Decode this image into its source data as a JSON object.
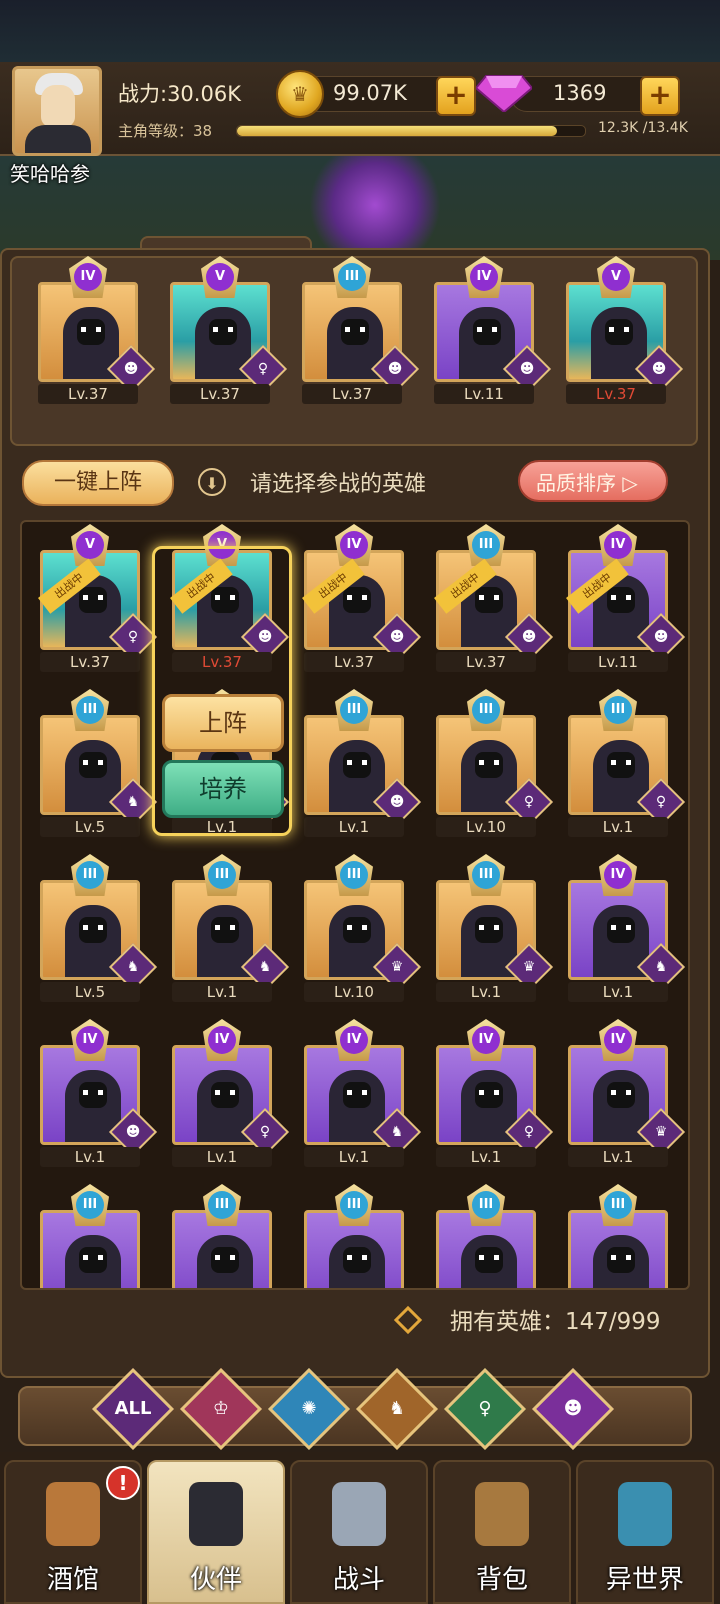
{
  "player": {
    "name": "笑哈哈参",
    "power": "战力:30.06K",
    "level_label": "主角等级：38",
    "xp_text": "12.3K /13.4K",
    "xp_fraction": 0.92
  },
  "currency": {
    "gold": "99.07K",
    "gems": "1369"
  },
  "lineup": [
    {
      "rank": "IV",
      "level": "Lv.37",
      "bg": "orange",
      "faction": "demon"
    },
    {
      "rank": "V",
      "level": "Lv.37",
      "bg": "teal",
      "faction": "elf"
    },
    {
      "rank": "III",
      "level": "Lv.37",
      "bg": "orange",
      "faction": "demon"
    },
    {
      "rank": "IV",
      "level": "Lv.11",
      "bg": "purple",
      "faction": "demon"
    },
    {
      "rank": "V",
      "level": "Lv.37",
      "bg": "teal",
      "faction": "demon",
      "level_red": true
    }
  ],
  "controls": {
    "one_click": "一键上阵",
    "hint": "请选择参战的英雄",
    "sort": "品质排序 ▷"
  },
  "deployed_tag": "出战中",
  "popup": {
    "deploy": "上阵",
    "train": "培养"
  },
  "roster": [
    {
      "rank": "V",
      "level": "Lv.37",
      "bg": "teal",
      "faction": "elf",
      "deployed": true
    },
    {
      "rank": "V",
      "level": "Lv.37",
      "bg": "teal",
      "faction": "demon",
      "deployed": true,
      "level_red": true
    },
    {
      "rank": "IV",
      "level": "Lv.37",
      "bg": "orange",
      "faction": "demon",
      "deployed": true
    },
    {
      "rank": "III",
      "level": "Lv.37",
      "bg": "orange",
      "faction": "demon",
      "deployed": true
    },
    {
      "rank": "IV",
      "level": "Lv.11",
      "bg": "purple",
      "faction": "demon",
      "deployed": true
    },
    {
      "rank": "III",
      "level": "Lv.5",
      "bg": "orange",
      "faction": "beast"
    },
    {
      "rank": "III",
      "level": "Lv.1",
      "bg": "orange",
      "faction": "beast"
    },
    {
      "rank": "III",
      "level": "Lv.1",
      "bg": "orange",
      "faction": "demon"
    },
    {
      "rank": "III",
      "level": "Lv.10",
      "bg": "orange",
      "faction": "elf"
    },
    {
      "rank": "III",
      "level": "Lv.1",
      "bg": "orange",
      "faction": "elf"
    },
    {
      "rank": "III",
      "level": "Lv.5",
      "bg": "orange",
      "faction": "beast"
    },
    {
      "rank": "III",
      "level": "Lv.1",
      "bg": "orange",
      "faction": "beast"
    },
    {
      "rank": "III",
      "level": "Lv.10",
      "bg": "orange",
      "faction": "human"
    },
    {
      "rank": "III",
      "level": "Lv.1",
      "bg": "orange",
      "faction": "human"
    },
    {
      "rank": "IV",
      "level": "Lv.1",
      "bg": "purple",
      "faction": "beast"
    },
    {
      "rank": "IV",
      "level": "Lv.1",
      "bg": "purple",
      "faction": "demon"
    },
    {
      "rank": "IV",
      "level": "Lv.1",
      "bg": "purple",
      "faction": "elf"
    },
    {
      "rank": "IV",
      "level": "Lv.1",
      "bg": "purple",
      "faction": "beast"
    },
    {
      "rank": "IV",
      "level": "Lv.1",
      "bg": "purple",
      "faction": "elf"
    },
    {
      "rank": "IV",
      "level": "Lv.1",
      "bg": "purple",
      "faction": "human"
    },
    {
      "rank": "III",
      "level": "",
      "bg": "purple",
      "faction": ""
    },
    {
      "rank": "III",
      "level": "",
      "bg": "purple",
      "faction": ""
    },
    {
      "rank": "III",
      "level": "",
      "bg": "purple",
      "faction": ""
    },
    {
      "rank": "III",
      "level": "",
      "bg": "purple",
      "faction": ""
    },
    {
      "rank": "III",
      "level": "",
      "bg": "purple",
      "faction": ""
    }
  ],
  "owned": "拥有英雄：147/999",
  "filters": [
    {
      "label": "ALL",
      "icon": "all-filter-icon",
      "color": "#5c2a78"
    },
    {
      "label": "",
      "icon": "human-faction-icon",
      "color": "#a0365a"
    },
    {
      "label": "",
      "icon": "fish-faction-icon",
      "color": "#2f86b8"
    },
    {
      "label": "",
      "icon": "beast-faction-icon",
      "color": "#a0652a"
    },
    {
      "label": "",
      "icon": "elf-faction-icon",
      "color": "#2f7a4a"
    },
    {
      "label": "",
      "icon": "demon-faction-icon",
      "color": "#7a2f9a"
    }
  ],
  "nav": [
    {
      "label": "酒馆",
      "icon": "tavern-icon",
      "badge": "!"
    },
    {
      "label": "伙伴",
      "icon": "companion-icon",
      "active": true
    },
    {
      "label": "战斗",
      "icon": "battle-icon"
    },
    {
      "label": "背包",
      "icon": "backpack-icon"
    },
    {
      "label": "异世界",
      "icon": "portal-icon"
    }
  ],
  "colors": {
    "gold": "#f6d25b",
    "panel": "#3a2b1e",
    "accent_red": "#e04a35"
  }
}
